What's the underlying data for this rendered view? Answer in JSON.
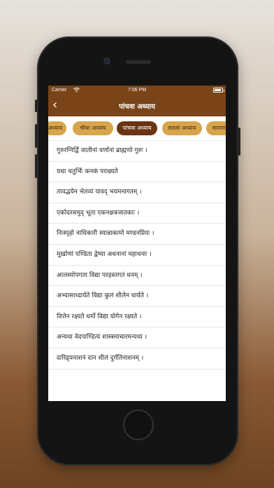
{
  "status_bar": {
    "carrier": "Carrier",
    "time": "7:06 PM",
    "battery_level": 0.9
  },
  "header": {
    "back_glyph": "‹",
    "title": "पांचवा अध्याय"
  },
  "chapter_tabs": [
    {
      "label": "अध्याय",
      "active": false
    },
    {
      "label": "चौथा अध्याय",
      "active": false
    },
    {
      "label": "पांचवा अध्याय",
      "active": true
    },
    {
      "label": "छठवां अध्याय",
      "active": false
    },
    {
      "label": "सातवा",
      "active": false
    }
  ],
  "verses": [
    "गुरुरग्निर्द्विं जातीनां वर्णानां ब्राह्मणो गुरुः ।",
    "यथा चतुर्भिः कनकं पराक्ष्यते",
    "तावद्भयेन भेतव्यं यावद् भयमनागतम् ।",
    "एकोदरसमुद् भूता एकनक्षत्रजातकाः ।",
    "निःस्पृहो नाधिकारी स्यान्नाकामो मण्डनप्रियः ।",
    "मूर्खाणां पण्डिता द्वेष्या अधनानां महाधनाः ।",
    "आलस्योपगता विद्या परहस्तगतं धनम् ।",
    "अभ्यासाध्दार्यते विद्या कुलं शीलेन धार्यते ।",
    "वित्तेन रक्ष्यते धर्मो विद्या योगेन रक्ष्यते ।",
    "अन्यथा वेदपाण्डित्यं शास्त्रमाचारमन्यथा ।",
    "दारिद्र्यनाशनं दान शीलं दुर्गतिनाशनम् ।"
  ],
  "colors": {
    "header_brown": "#7a4418",
    "chip_gold": "#d7a54c",
    "chip_active": "#6b3413"
  }
}
